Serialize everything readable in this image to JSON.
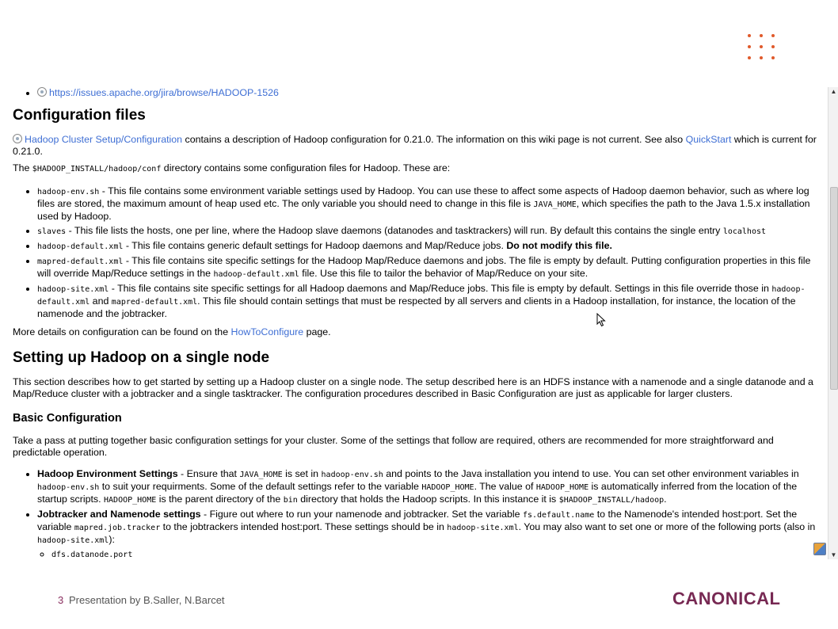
{
  "top_link": "https://issues.apache.org/jira/browse/HADOOP-1526",
  "config_heading": "Configuration files",
  "intro": {
    "link1": "Hadoop Cluster Setup/Configuration",
    "text1": " contains a description of Hadoop configuration for 0.21.0. The information on this wiki page is not current. See also ",
    "link2": "QuickStart",
    "text2": " which is current for 0.21.0."
  },
  "conf_dir": {
    "pre": "The ",
    "code": "$HADOOP_INSTALL/hadoop/conf",
    "post": " directory contains some configuration files for Hadoop. These are:"
  },
  "config_items": [
    {
      "code": "hadoop-env.sh",
      "text": " - This file contains some environment variable settings used by Hadoop. You can use these to affect some aspects of Hadoop daemon behavior, such as where log files are stored, the maximum amount of heap used etc. The only variable you should need to change in this file is ",
      "code2": "JAVA_HOME",
      "text2": ", which specifies the path to the Java 1.5.x installation used by Hadoop."
    },
    {
      "code": "slaves",
      "text": " - This file lists the hosts, one per line, where the Hadoop slave daemons (datanodes and tasktrackers) will run. By default this contains the single entry ",
      "code2": "localhost",
      "text2": ""
    },
    {
      "code": "hadoop-default.xml",
      "text": " - This file contains generic default settings for Hadoop daemons and Map/Reduce jobs. ",
      "bold": "Do not modify this file."
    },
    {
      "code": "mapred-default.xml",
      "text": " - This file contains site specific settings for the Hadoop Map/Reduce daemons and jobs. The file is empty by default. Putting configuration properties in this file will override Map/Reduce settings in the ",
      "code2": "hadoop-default.xml",
      "text2": " file. Use this file to tailor the behavior of Map/Reduce on your site."
    },
    {
      "code": "hadoop-site.xml",
      "text": " - This file contains site specific settings for all Hadoop daemons and Map/Reduce jobs. This file is empty by default. Settings in this file override those in ",
      "code2": "hadoop-default.xml",
      "text2": " and ",
      "code3": "mapred-default.xml",
      "text3": ". This file should contain settings that must be respected by all servers and clients in a Hadoop installation, for instance, the location of the namenode and the jobtracker."
    }
  ],
  "more_details": {
    "pre": "More details on configuration can be found on the ",
    "link": "HowToConfigure",
    "post": " page."
  },
  "single_node_heading": "Setting up Hadoop on a single node",
  "single_node_para": "This section describes how to get started by setting up a Hadoop cluster on a single node. The setup described here is an HDFS instance with a namenode and a single datanode and a Map/Reduce cluster with a jobtracker and a single tasktracker. The configuration procedures described in Basic Configuration are just as applicable for larger clusters.",
  "basic_config_heading": "Basic Configuration",
  "basic_config_para": "Take a pass at putting together basic configuration settings for your cluster. Some of the settings that follow are required, others are recommended for more straightforward and predictable operation.",
  "basic_items": {
    "env": {
      "bold": "Hadoop Environment Settings",
      "t1": " - Ensure that ",
      "c1": "JAVA_HOME",
      "t2": " is set in ",
      "c2": "hadoop-env.sh",
      "t3": " and points to the Java installation you intend to use. You can set other environment variables in ",
      "c3": "hadoop-env.sh",
      "t4": " to suit your requirments. Some of the default settings refer to the variable ",
      "c4": "HADOOP_HOME",
      "t5": ". The value of ",
      "c5": "HADOOP_HOME",
      "t6": " is automatically inferred from the location of the startup scripts. ",
      "c6": "HADOOP_HOME",
      "t7": " is the parent directory of the ",
      "c7": "bin",
      "t8": " directory that holds the Hadoop scripts. In this instance it is ",
      "c8": "$HADOOP_INSTALL/hadoop",
      "t9": "."
    },
    "jobtracker": {
      "bold": "Jobtracker and Namenode settings",
      "t1": " - Figure out where to run your namenode and jobtracker. Set the variable ",
      "c1": "fs.default.name",
      "t2": " to the Namenode's intended host:port. Set the variable ",
      "c2": "mapred.job.tracker",
      "t3": " to the jobtrackers intended host:port. These settings should be in ",
      "c3": "hadoop-site.xml",
      "t4": ". You may also want to set one or more of the following ports (also in ",
      "c4": "hadoop-site.xml",
      "t5": "):"
    },
    "cut_item": "dfs.datanode.port"
  },
  "footer": {
    "page_number": "3",
    "credit": "Presentation by B.Saller, N.Barcet",
    "logo": "CANONICAL"
  },
  "colors": {
    "link": "#3f6fd4",
    "brand": "#772953",
    "dots": "#e05a2b"
  }
}
